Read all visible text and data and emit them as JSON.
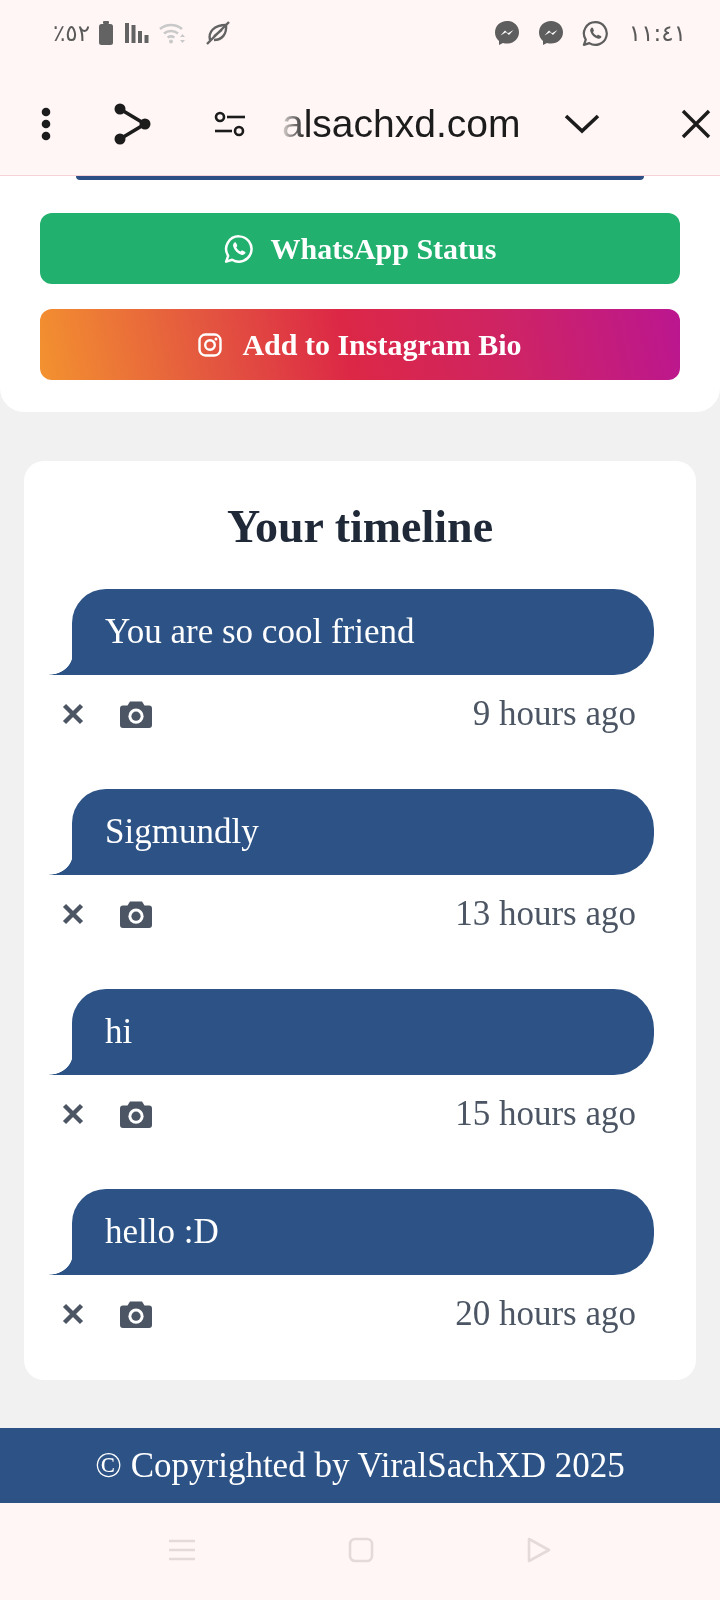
{
  "status_bar": {
    "battery_text": "٪٥٢",
    "time": "١١:٤١"
  },
  "browser_toolbar": {
    "url": "alsachxd.com"
  },
  "share_buttons": [
    {
      "kind": "whatsapp",
      "label": "WhatsApp Status"
    },
    {
      "kind": "instagram",
      "label": "Add to Instagram Bio"
    }
  ],
  "timeline": {
    "title": "Your timeline",
    "messages": [
      {
        "text": "You are so cool friend",
        "time": "9 hours ago"
      },
      {
        "text": "Sigmundly",
        "time": "13 hours ago"
      },
      {
        "text": "hi",
        "time": "15 hours ago"
      },
      {
        "text": "hello :D",
        "time": "20 hours ago"
      }
    ]
  },
  "footer": {
    "text": "© Copyrighted by ViralSachXD 2025"
  }
}
